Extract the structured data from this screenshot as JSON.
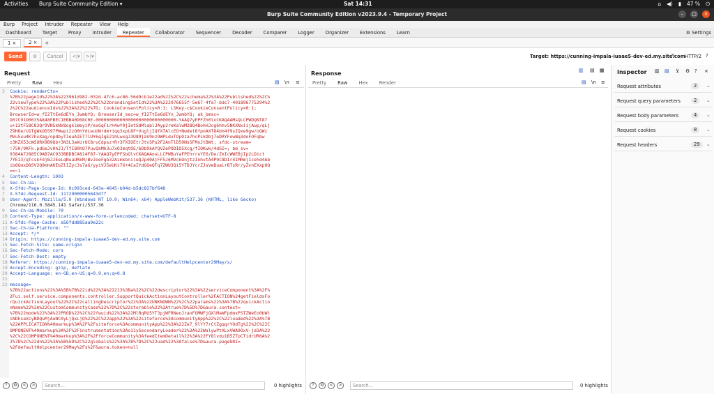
{
  "os": {
    "activities": "Activities",
    "app": "Burp Suite Community Edition ▾",
    "clock": "Sat 14:31",
    "battery": "47 %"
  },
  "window": {
    "title": "Burp Suite Community Edition v2023.9.4 - Temporary Project"
  },
  "menu": [
    "Burp",
    "Project",
    "Intruder",
    "Repeater",
    "View",
    "Help"
  ],
  "tabs": [
    "Dashboard",
    "Target",
    "Proxy",
    "Intruder",
    "Repeater",
    "Collaborator",
    "Sequencer",
    "Decoder",
    "Comparer",
    "Logger",
    "Organizer",
    "Extensions",
    "Learn"
  ],
  "active_tab": "Repeater",
  "settings_label": "Settings",
  "subtabs": [
    "1 ×",
    "2 ×",
    "+"
  ],
  "toolbar": {
    "send": "Send",
    "cancel": "Cancel",
    "target": "Target: https://cunning-impala-iuaae5-dev-ed.my.site.com",
    "http": "HTTP/2"
  },
  "request": {
    "title": "Request",
    "views": [
      "Pretty",
      "Raw",
      "Hex"
    ],
    "active_view": "Raw",
    "lines": [
      {
        "n": "3",
        "text": "Cookie: renderCtx=",
        "cls": "k"
      },
      {
        "n": "",
        "text": "%7B%22pageId%22%3A%223961d982-032d-4fc6-ac86-56d9cb1e22ad%22%2C%22schema%22%3A%22Published%22%2C%",
        "cls": "r"
      },
      {
        "n": "",
        "text": "22viewType%22%3A%22Published%22%2C%22brandingSetId%22%3A%222076655f-5e67-4fa7-bdc7-401896775294%2",
        "cls": "r"
      },
      {
        "n": "",
        "text": "2%2C%22audienceIds%22%3A%22%22%7D; CookieConsentPolicy=0:1; LSKey-c$CookieConsentPolicy=0:1;",
        "cls": "r"
      },
      {
        "n": "",
        "text": "BrowserId=w_fI2TtEe6dEYn_JwmbYQ; BrowserId_sec=w_fI2TtEe6dEYn_JwmbYQ; ak_bmsc=",
        "cls": "r"
      },
      {
        "n": "",
        "text": "D07C91D0635A848FBEC1EBB40D08C0E-000000000000000000000000000000-YAAQ7yEPFZh0lvCKAQAAMsQLCPWDQNT87",
        "cls": "r"
      },
      {
        "n": "",
        "text": "u+13tF58C83Qr9VN5kNV8ogklWeyiP/exGqFirH4wY0jIetS8MlablJAyp2reKalwM2BQ4BohHJcg6hhv5NKXNxiijAwp/qLj",
        "cls": "r"
      },
      {
        "n": "",
        "text": "Z9H6e/U1TgWkOD597PWwpi2zO0hYdLwuUWrdm+iqq3xpL8F+VugljIQfX7AlcEO+Nwdet8fpnAXT84bh4f9sIQxe9gw/oQWz",
        "cls": "r"
      },
      {
        "n": "",
        "text": "MVu5xu4K7hxXag/opdbyT1euAIET7lUY6qIgE2ihLwxgJ3U89jaV9nz9WPLdxTOpOza7hcPskObj7eDRYFowBq3doFOFqbw",
        "cls": "r"
      },
      {
        "n": "",
        "text": "z3KZX53cWSURX9B9Qb+3N3L3akUrOC8ruCdpsz+Rr3FXIOEtrJtvSPu2F2AnTlD50NsSFMoJtBWt; sfdc-stream=",
        "cls": "r"
      },
      {
        "n": "",
        "text": "!750/9KFk.pdGeJv0hJJ/TfI80hQ7PuvQkMh3u7xO3mqtOE/bDb9kAYQVZePODID5Xcg/fIOKwk/4dGI=; bm_sv=",
        "cls": "r"
      },
      {
        "n": "",
        "text": "9384A72885C9AB7AC933BBDBCA814F87-YAAQ7yEPFSbQlvCKAQAAosLLCPWBuYaFPEhrruYE6/De/ZkIcWWEBjIp2LDict",
        "cls": "r"
      },
      {
        "n": "",
        "text": "7YEI3/qTcskFdjBJJEeLqNuaURkM/BvJoeFgb32AimkbnileQJp40AjFF5J6MVc6OnjtzInhvtA4P9C8DIr4IMRmjIcehd4Ab",
        "cls": "r"
      },
      {
        "n": "",
        "text": "ib6GmxD8SV2Q9mhAKEbZlIZyc3s7aG/yyiVJ5eUKi7X+4CaIYdGOeQTq7ZWU3Qi5YTDJYcrZJsVeBuaL+BTsRr/yZvnEXxp0Q",
        "cls": "r"
      },
      {
        "n": "",
        "text": "==~1",
        "cls": "r"
      },
      {
        "n": "4",
        "text": "Content-Length: 1003",
        "cls": "k"
      },
      {
        "n": "5",
        "text": "Sec-Ch-Ua:",
        "cls": "k"
      },
      {
        "n": "6",
        "text": "X-Sfdc-Page-Scope-Id: 8c093ced-643e-4645-b04d-b5dc827bf648",
        "cls": "k"
      },
      {
        "n": "7",
        "text": "X-Sfdc-Request-Id: 11729000005643d7f",
        "cls": "k"
      },
      {
        "n": "8",
        "text": "User-Agent: Mozilla/5.0 (Windows NT 10.0; Win64; x64) AppleWebKit/537.36 (KHTML, like Gecko)",
        "cls": "k"
      },
      {
        "n": "",
        "text": "Chrome/116.0.5845.141 Safari/537.36",
        "cls": "v"
      },
      {
        "n": "9",
        "text": "Sec-Ch-Ua-Mobile: ?0",
        "cls": "k"
      },
      {
        "n": "10",
        "text": "Content-Type: application/x-www-form-urlencoded; charset=UTF-8",
        "cls": "k"
      },
      {
        "n": "11",
        "text": "X-Sfdc-Page-Cache: a56fdd885aa9e22c",
        "cls": "k"
      },
      {
        "n": "12",
        "text": "Sec-Ch-Ua-Platform: \"\"",
        "cls": "k"
      },
      {
        "n": "13",
        "text": "Accept: */*",
        "cls": "k"
      },
      {
        "n": "14",
        "text": "Origin: https://cunning-impala-iuaae5-dev-ed.my.site.com",
        "cls": "k"
      },
      {
        "n": "15",
        "text": "Sec-Fetch-Site: same-origin",
        "cls": "k"
      },
      {
        "n": "16",
        "text": "Sec-Fetch-Mode: cors",
        "cls": "k"
      },
      {
        "n": "17",
        "text": "Sec-Fetch-Dest: empty",
        "cls": "k"
      },
      {
        "n": "18",
        "text": "Referer: https://cunning-impala-iuaae5-dev-ed.my.site.com/defaultHelpcenter29May/s/",
        "cls": "k"
      },
      {
        "n": "19",
        "text": "Accept-Encoding: gzip, deflate",
        "cls": "k"
      },
      {
        "n": "20",
        "text": "Accept-Language: en-GB,en-US;q=0.9,en;q=0.8",
        "cls": "k"
      },
      {
        "n": "21",
        "text": "",
        "cls": "v"
      },
      {
        "n": "22",
        "text": "message=",
        "cls": "k"
      },
      {
        "n": "",
        "text": "%7B%22actions%22%3A%5B%7B%22id%22%3A%22213%3Ba%22%2C%22descriptor%22%3A%22serviceComponent%3A%2F%",
        "cls": "r"
      },
      {
        "n": "",
        "text": "2Fui.self.service.components.controller.SupportQuickActionLayoutController%2FACTION%24getFieldsFo",
        "cls": "r"
      },
      {
        "n": "",
        "text": "rQuickActionLayout%22%2C%22callingDescriptor%22%3A%22UNKNOWN%22%2C%22params%22%3A%7B%22quickActio",
        "cls": "r"
      },
      {
        "n": "",
        "text": "nName%22%3A%22CustomCommunityCase%22%7D%2C%22storable%22%3Atrue%7D%5D%7D&aura.context=",
        "cls": "r"
      },
      {
        "n": "",
        "text": "%7B%22mode%22%3A%22PROD%22%2C%22fwuid%22%3A%22MlRqRU5YT3pjWFRNenJranFOMWFjQXlMaWFpdmxPSTZWeEo0bWt",
        "cls": "r"
      },
      {
        "n": "",
        "text": "iNDhsaXcyNDQuMjAuNC0yLjQxLjQ%22%2C%22app%22%3A%22siteforce%3AcommunityApp%22%2C%22loaded%22%3A%7B",
        "cls": "r"
      },
      {
        "n": "",
        "text": "%22APPLICATION%40markup%3A%2F%2Fsiteforce%3AcommunityApp%22%3A%22Ze7_9lYY7rCtZgqqrYOdTg%22%2C%22C",
        "cls": "r"
      },
      {
        "n": "",
        "text": "OMPONENT%40markup%3A%2F%2Finstrumentation%3Ao11ySecondaryLoader%22%3A%22WalywPtXLxVWA9OxV-jd3A%22",
        "cls": "r"
      },
      {
        "n": "",
        "text": "%2C%22COMPONENT%40markup%3A%2F%2FforceCommunity%3AfeedItemDetail%22%3A%22FY8lvdu1B5ZTpCTidrUR6A%2",
        "cls": "r"
      },
      {
        "n": "",
        "text": "2%7D%2C%22dn%22%3A%5B%5D%2C%22globals%22%3A%7B%7D%2C%22uad%22%3Afalse%7D&aura.pageURI=",
        "cls": "r"
      },
      {
        "n": "",
        "text": "%2FdefaultHelpcenter29May%2Fs%2F&aura.token=null",
        "cls": "r"
      }
    ]
  },
  "response": {
    "title": "Response",
    "views": [
      "Pretty",
      "Raw",
      "Hex",
      "Render"
    ],
    "active_view": "Raw"
  },
  "search": {
    "placeholder": "Search...",
    "highlights": "0 highlights"
  },
  "inspector": {
    "title": "Inspector",
    "rows": [
      {
        "label": "Request attributes",
        "count": "2"
      },
      {
        "label": "Request query parameters",
        "count": "2"
      },
      {
        "label": "Request body parameters",
        "count": "4"
      },
      {
        "label": "Request cookies",
        "count": "8"
      },
      {
        "label": "Request headers",
        "count": "29"
      }
    ]
  }
}
